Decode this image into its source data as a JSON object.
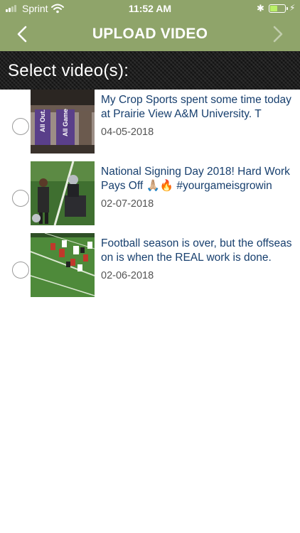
{
  "status_bar": {
    "carrier": "Sprint",
    "time": "11:52 AM",
    "battery_level": 0.5,
    "icons": [
      "signal-icon",
      "wifi-icon",
      "bluetooth-icon",
      "battery-icon",
      "charging-icon"
    ]
  },
  "nav": {
    "title": "UPLOAD VIDEO",
    "back_icon": "chevron-left-icon",
    "forward_icon": "chevron-right-icon"
  },
  "banner": {
    "title": "Select video(s):"
  },
  "videos": [
    {
      "title": "My Crop Sports spent some time today at Prairie View A&M University. T",
      "date": "04-05-2018",
      "selected": false
    },
    {
      "title": "National Signing Day 2018! Hard Work Pays Off 🙏🏼🔥 #yourgameisgrowin",
      "date": "02-07-2018",
      "selected": false
    },
    {
      "title": "Football season is over, but the offseason is when the REAL work is done.",
      "date": "02-06-2018",
      "selected": false
    }
  ],
  "thumbnail_text": {
    "banner_1": "All Out.",
    "banner_2": "All Game"
  },
  "colors": {
    "header": "#8fa46a",
    "title_text": "#173f6e",
    "date_text": "#555555"
  }
}
